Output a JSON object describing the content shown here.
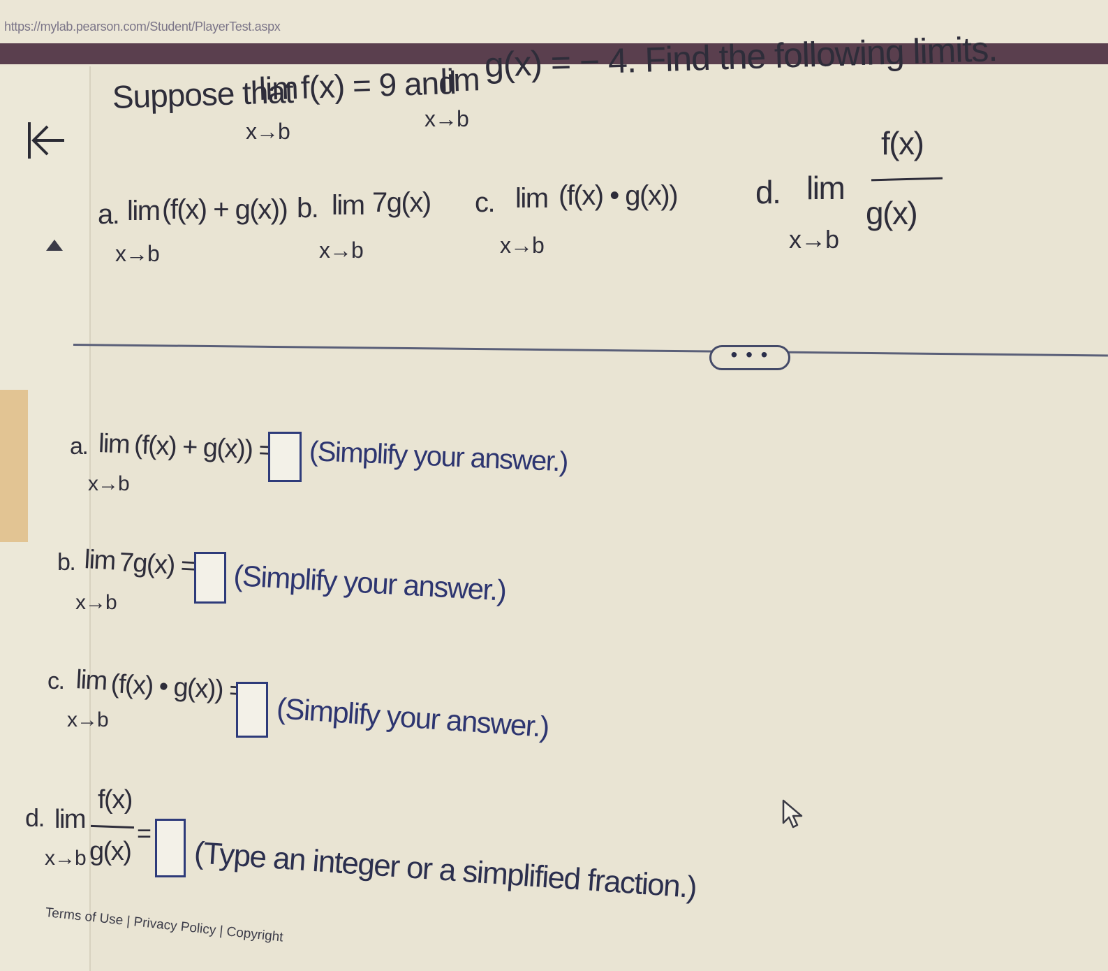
{
  "browser": {
    "url": "https://mylab.pearson.com/Student/PlayerTest.aspx"
  },
  "question": {
    "intro_prefix": "Suppose that",
    "lim_word": "lim",
    "f_limit": "f(x) = 9 and",
    "g_limit": "g(x) = − 4. Find the following limits.",
    "subscript": "x→b",
    "parts": {
      "a_label": "a.",
      "a_expr": "(f(x) + g(x))",
      "b_label": "b.",
      "b_expr": "7g(x)",
      "c_label": "c.",
      "c_expr": "(f(x) • g(x))",
      "d_label": "d.",
      "d_num": "f(x)",
      "d_den": "g(x)"
    }
  },
  "more_button": "• • •",
  "answers": {
    "a_expr": "(f(x) + g(x)) =",
    "b_expr": "7g(x) =",
    "c_expr": "(f(x) • g(x)) =",
    "d_eq": "=",
    "hint_simplify": "(Simplify your answer.)",
    "hint_fraction": "(Type an integer or a simplified fraction.)"
  },
  "footer": "Terms of Use | Privacy Policy | Copyright"
}
